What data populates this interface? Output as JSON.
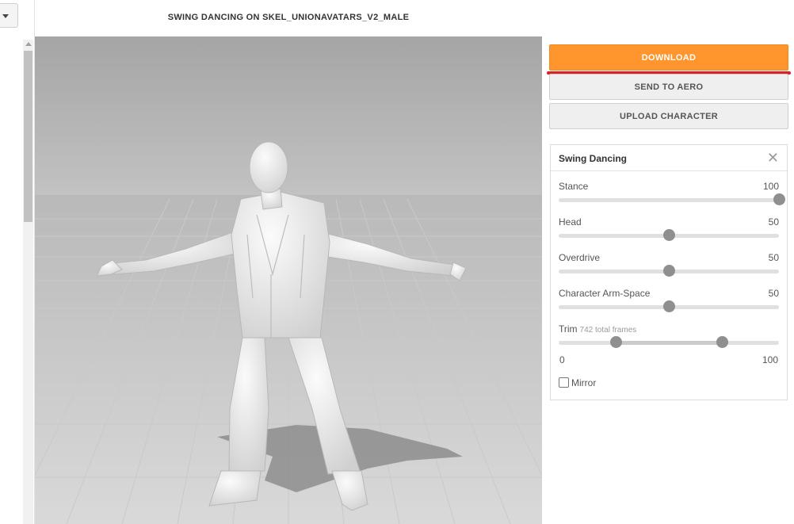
{
  "title": "SWING DANCING ON SKEL_UNIONAVATARS_V2_MALE",
  "colors": {
    "accent": "#ff952d",
    "highlight": "#d8202a"
  },
  "icons": {
    "dropdown": "chevron-down-icon",
    "close": "close-icon"
  },
  "actions": {
    "download_label": "DOWNLOAD",
    "send_label": "SEND TO AERO",
    "upload_label": "UPLOAD CHARACTER"
  },
  "settings": {
    "title": "Swing Dancing",
    "close_symbol": "✕",
    "sliders": [
      {
        "label": "Stance",
        "value": "100",
        "fraction": 1.0
      },
      {
        "label": "Head",
        "value": "50",
        "fraction": 0.5
      },
      {
        "label": "Overdrive",
        "value": "50",
        "fraction": 0.5
      },
      {
        "label": "Character Arm-Space",
        "value": "50",
        "fraction": 0.5
      }
    ],
    "trim": {
      "label": "Trim",
      "note": "742 total frames",
      "min": "0",
      "max": "100",
      "range_start": 0.26,
      "range_end": 0.74
    },
    "mirror": {
      "label": "Mirror",
      "checked": false
    }
  }
}
